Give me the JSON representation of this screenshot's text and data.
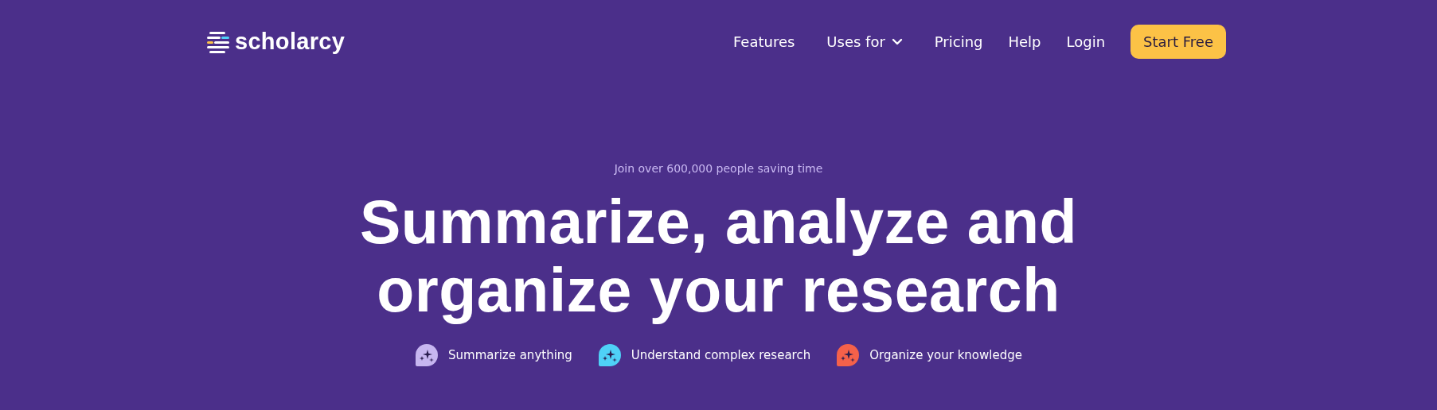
{
  "brand": {
    "name": "scholarcy"
  },
  "nav": [
    {
      "label": "Features",
      "kind": "link"
    },
    {
      "label": "Uses for",
      "kind": "dropdown"
    },
    {
      "label": "Pricing",
      "kind": "link"
    },
    {
      "label": "Help",
      "kind": "link"
    },
    {
      "label": "Login",
      "kind": "link"
    },
    {
      "label": "Start Free",
      "kind": "button"
    }
  ],
  "hero": {
    "eyebrow": "Join over 600,000 people saving time",
    "headline": [
      "Summarize, analyze and",
      "organize your research"
    ],
    "features": [
      {
        "label": "Summarize anything",
        "color": "#c7b6f0"
      },
      {
        "label": "Understand complex research",
        "color": "#4fd1f7"
      },
      {
        "label": "Organize your knowledge",
        "color": "#f5614a"
      }
    ]
  }
}
